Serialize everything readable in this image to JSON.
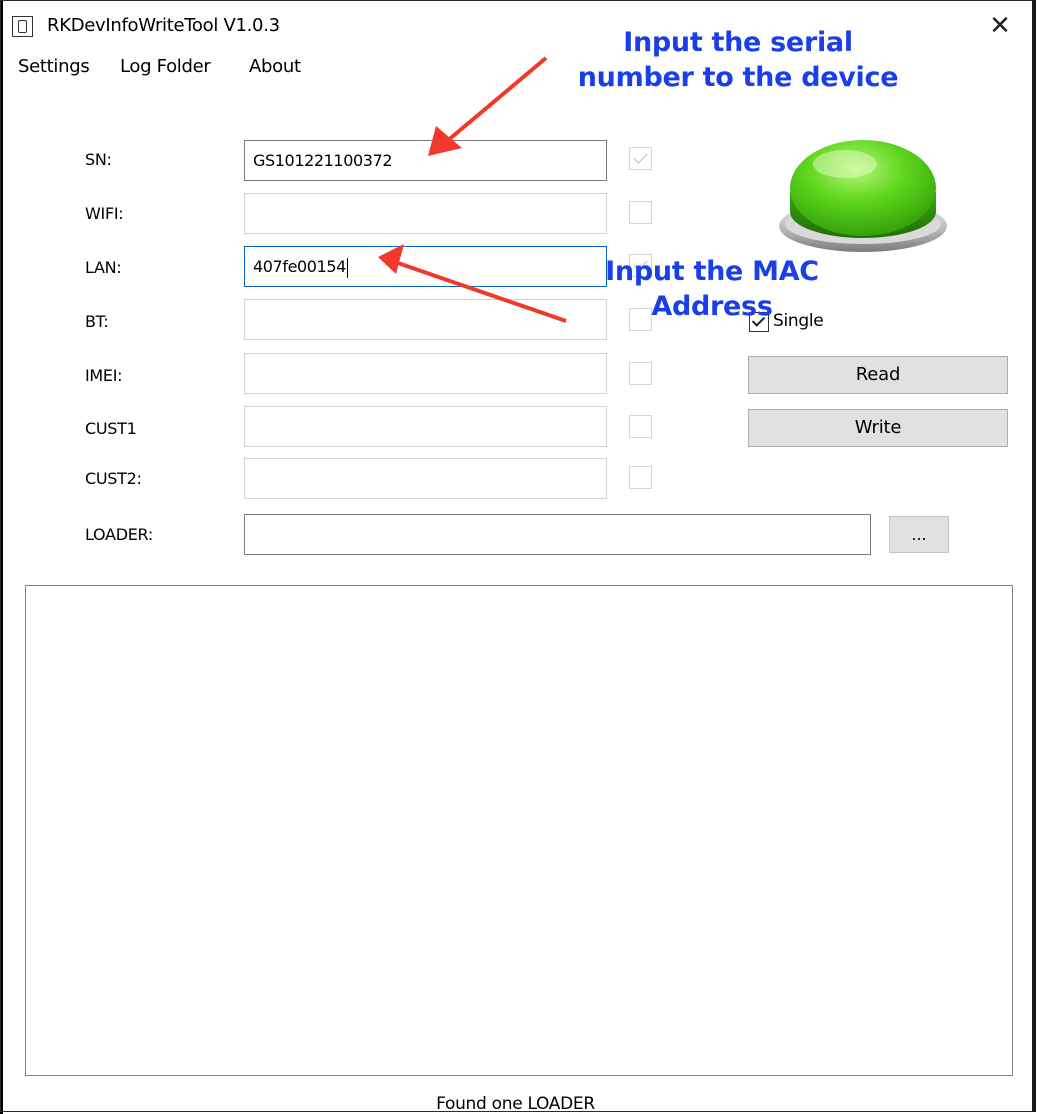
{
  "window": {
    "title": "RKDevInfoWriteTool V1.0.3",
    "close_glyph": "✕"
  },
  "menu": [
    "Settings",
    "Log Folder",
    "About"
  ],
  "fields": [
    {
      "label": "SN:",
      "value": "GS101221100372",
      "checked": true
    },
    {
      "label": "WIFI:",
      "value": "",
      "checked": false
    },
    {
      "label": "LAN:",
      "value": "407fe00154",
      "checked": true
    },
    {
      "label": "BT:",
      "value": "",
      "checked": false
    },
    {
      "label": "IMEI:",
      "value": "",
      "checked": false
    },
    {
      "label": "CUST1",
      "value": "",
      "checked": false
    },
    {
      "label": "CUST2:",
      "value": "",
      "checked": false
    }
  ],
  "loader": {
    "label": "LOADER:",
    "value": "",
    "browse_label": "..."
  },
  "options": {
    "single_label": "Single",
    "single_checked": true
  },
  "buttons": {
    "read": "Read",
    "write": "Write"
  },
  "status": "Found one LOADER",
  "annotations": {
    "serial": [
      "Input the serial",
      "number to the device"
    ],
    "mac": [
      "Input the MAC",
      "Address"
    ]
  },
  "colors": {
    "annotation_text": "#1a3fe8",
    "arrow": "#f0392b",
    "button_green": "#5fd61c"
  },
  "icons": {
    "app": "app-icon",
    "close": "close-icon",
    "green_button": "green-button-icon"
  }
}
